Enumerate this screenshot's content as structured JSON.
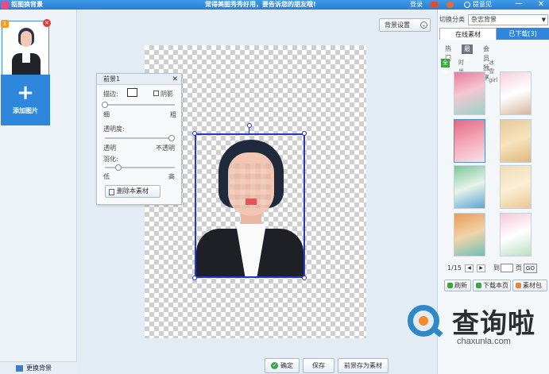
{
  "titlebar": {
    "app_title": "抠图换背景",
    "promo": "觉得美图秀秀好用，要告诉您的朋友哦!",
    "login": "登录",
    "feedback": "提意见",
    "minimize": "—",
    "close": "✕"
  },
  "left": {
    "thumb_index": "1",
    "thumb_delete": "✕",
    "add_plus": "+",
    "add_label": "添加图片",
    "change_bg": "更换背景"
  },
  "toolbar": {
    "bg_settings": "背景设置",
    "bg_settings_chev": "⌄"
  },
  "fg_panel": {
    "title": "前景1",
    "close": "✕",
    "border_label": "描边:",
    "shadow_label": "阴影",
    "thin": "细",
    "thick": "粗",
    "opacity_label": "透明度:",
    "transparent": "透明",
    "opaque": "不透明",
    "feather_label": "羽化:",
    "low": "低",
    "high": "高",
    "delete_btn": "删除本素材",
    "border_value": 0.0,
    "opacity_value": 1.0,
    "feather_value": 0.2
  },
  "bottom": {
    "confirm": "确定",
    "confirm_icon": "✓",
    "save": "保存",
    "save_as_material": "前景存为素材"
  },
  "right": {
    "switch_label": "切换分类",
    "category": "杂志背景",
    "category_arrow": "▼",
    "tab_online": "在线素材",
    "tab_downloaded": "已下载[3]",
    "subtabs": [
      "热门",
      "最新",
      "会员独享"
    ],
    "filters": [
      "全部",
      "时尚girl",
      "冰雪girl"
    ],
    "pager": {
      "page": "1/15",
      "prev": "◀",
      "next": "▶",
      "to": "到",
      "page_word": "页",
      "go": "GO"
    },
    "refresh": "刷新",
    "download_page": "下载本页",
    "material_pack": "素材包"
  },
  "watermark": {
    "cn": "查询啦",
    "en": "chaxunla.com"
  },
  "colors": {
    "title_blue": "#2a7fd4",
    "frame_blue": "#2438c8",
    "tab_blue": "#2f87dd",
    "filter_green": "#3aa640"
  }
}
